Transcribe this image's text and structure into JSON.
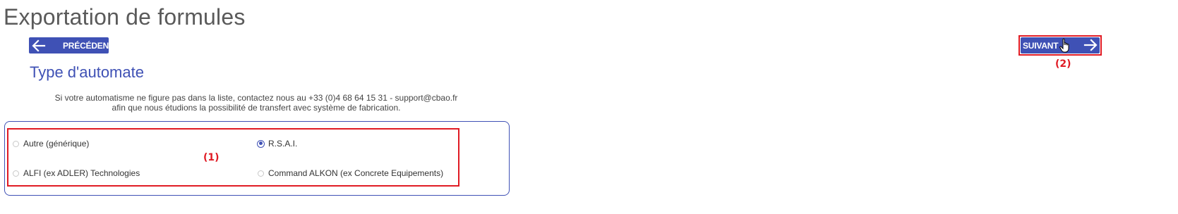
{
  "page": {
    "title": "Exportation de formules"
  },
  "nav": {
    "prev_label": "PRÉCÉDENT",
    "next_label": "SUIVANT",
    "prev_icon": "arrow-left-icon",
    "next_icon": "arrow-right-icon",
    "accent_color": "#3f51b5"
  },
  "section": {
    "title": "Type d'automate",
    "info_line1": "Si votre automatisme ne figure pas dans la liste, contactez nous au +33 (0)4 68 64 15 31 - support@cbao.fr",
    "info_line2": "afin que nous étudions la possibilité de transfert avec système de fabrication."
  },
  "options": [
    {
      "label": "Autre (générique)",
      "checked": false
    },
    {
      "label": "R.S.A.I.",
      "checked": true
    },
    {
      "label": "ALFI (ex ADLER) Technologies",
      "checked": false
    },
    {
      "label": "Command ALKON (ex Concrete Equipements)",
      "checked": false
    }
  ],
  "annotations": {
    "label_1": "(1)",
    "label_2": "(2)",
    "color": "#e01b24"
  }
}
